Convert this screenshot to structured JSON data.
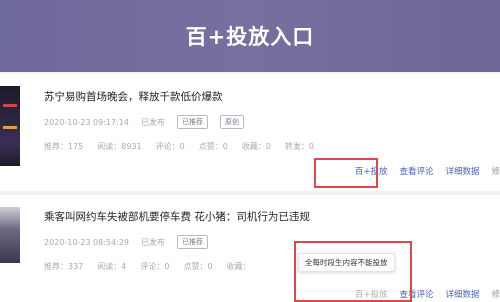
{
  "header": {
    "title": "百+投放入口"
  },
  "articles": [
    {
      "title": "苏宁易购首场晚会，释放千款低价爆款",
      "datetime": "2020-10-23 09:17:14",
      "status": "已发布",
      "tags": [
        "已推荐",
        "原创"
      ],
      "stats": [
        "推荐：175",
        "阅读：8931",
        "评论：0",
        "点赞：0",
        "收藏：0",
        "转发：0"
      ],
      "actions": [
        "百+投放",
        "查看评论",
        "详细数据",
        "修"
      ]
    },
    {
      "title": "乘客叫网约车失被部机要停车费 花小猪：司机行为已违规",
      "datetime": "2020-10-23 08:54:29",
      "status": "已发布",
      "tags": [
        "已推荐"
      ],
      "stats": [
        "推荐：337",
        "阅读：4",
        "评论：0",
        "点赞：0",
        "收藏："
      ],
      "actions": [
        "百+投放",
        "查看评论",
        "详细数据",
        "修"
      ],
      "tooltip": "全每时段生内容不能投放"
    }
  ]
}
